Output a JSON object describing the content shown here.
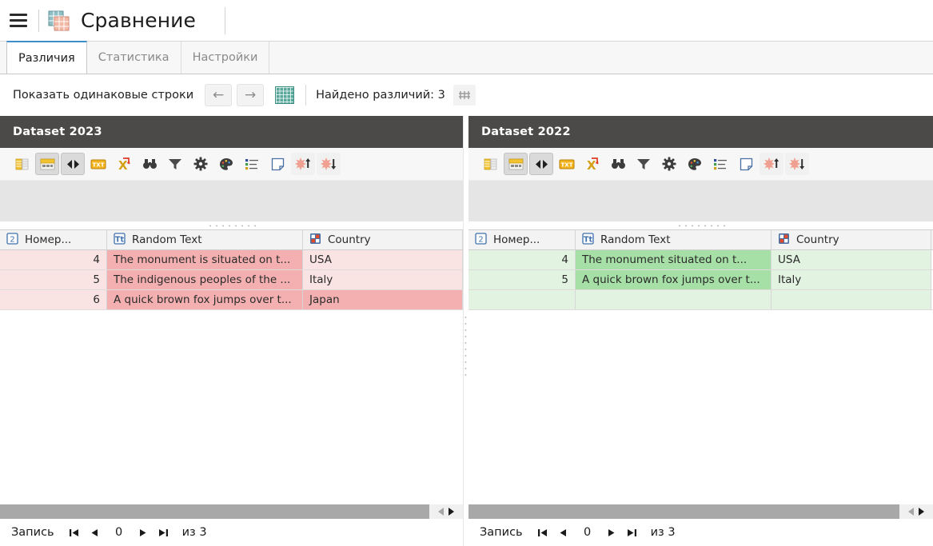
{
  "titlebar": {
    "menu_icon": "hamburger-icon",
    "app_icon": "compare-grid-icon",
    "title": "Сравнение"
  },
  "tabs": [
    {
      "label": "Различия",
      "active": true
    },
    {
      "label": "Статистика",
      "active": false
    },
    {
      "label": "Настройки",
      "active": false
    }
  ],
  "subbar": {
    "show_equal_rows_label": "Показать одинаковые строки",
    "prev_icon": "arrow-left-icon",
    "next_icon": "arrow-right-icon",
    "grid_icon": "grid-toggle-icon",
    "found_label": "Найдено различий: 3",
    "columns_icon": "columns-icon"
  },
  "toolbar_icons": [
    {
      "name": "column-stats-icon",
      "state": "normal"
    },
    {
      "name": "table-layout-icon",
      "state": "selected"
    },
    {
      "name": "compare-arrows-icon",
      "state": "selected"
    },
    {
      "name": "txt-export-icon",
      "state": "normal"
    },
    {
      "name": "excel-export-icon",
      "state": "normal"
    },
    {
      "name": "binoculars-icon",
      "state": "normal"
    },
    {
      "name": "filter-icon",
      "state": "normal"
    },
    {
      "name": "settings-gear-icon",
      "state": "normal"
    },
    {
      "name": "palette-icon",
      "state": "normal"
    },
    {
      "name": "list-icon",
      "state": "normal"
    },
    {
      "name": "note-icon",
      "state": "normal"
    },
    {
      "name": "sort-asc-icon",
      "state": "dim"
    },
    {
      "name": "sort-desc-icon",
      "state": "dim"
    }
  ],
  "panels": [
    {
      "id": "left",
      "title": "Dataset 2023",
      "highlight": "pink",
      "columns": [
        {
          "label": "Номер...",
          "type_icon": "number-type-icon"
        },
        {
          "label": "Random Text",
          "type_icon": "text-type-icon"
        },
        {
          "label": "Country",
          "type_icon": "category-type-icon"
        }
      ],
      "rows": [
        {
          "num": "4",
          "text": "The monument is situated on t...",
          "country": "USA",
          "num_hl": "light",
          "text_hl": "dark",
          "country_hl": "light"
        },
        {
          "num": "5",
          "text": "The indigenous peoples of the ...",
          "country": "Italy",
          "num_hl": "light",
          "text_hl": "dark",
          "country_hl": "light"
        },
        {
          "num": "6",
          "text": "A quick brown fox jumps over t...",
          "country": "Japan",
          "num_hl": "light",
          "text_hl": "dark",
          "country_hl": "dark"
        }
      ],
      "status": {
        "record_label": "Запись",
        "first_icon": "go-first-icon",
        "prev_icon": "go-prev-icon",
        "value": "0",
        "next_icon": "go-next-icon",
        "last_icon": "go-last-icon",
        "total_label": "из 3"
      }
    },
    {
      "id": "right",
      "title": "Dataset 2022",
      "highlight": "green",
      "columns": [
        {
          "label": "Номер...",
          "type_icon": "number-type-icon"
        },
        {
          "label": "Random Text",
          "type_icon": "text-type-icon"
        },
        {
          "label": "Country",
          "type_icon": "category-type-icon"
        }
      ],
      "rows": [
        {
          "num": "4",
          "text": "The monument situated on t...",
          "country": "USA",
          "num_hl": "light",
          "text_hl": "dark",
          "country_hl": "light"
        },
        {
          "num": "5",
          "text": "A quick brown fox jumps over t...",
          "country": "Italy",
          "num_hl": "light",
          "text_hl": "dark",
          "country_hl": "light"
        },
        {
          "num": "",
          "text": "",
          "country": "",
          "num_hl": "light",
          "text_hl": "light",
          "country_hl": "light"
        }
      ],
      "status": {
        "record_label": "Запись",
        "first_icon": "go-first-icon",
        "prev_icon": "go-prev-icon",
        "value": "0",
        "next_icon": "go-next-icon",
        "last_icon": "go-last-icon",
        "total_label": "из 3"
      }
    }
  ],
  "colors": {
    "accent_tab": "#3d8ec9",
    "panel_header_bg": "#4c4a48",
    "diff_pink_light": "#fae3e3",
    "diff_pink_dark": "#f4b0b0",
    "diff_green_light": "#e2f3e2",
    "diff_green_dark": "#a6e0a6",
    "grid_btn": "#59a89c"
  }
}
